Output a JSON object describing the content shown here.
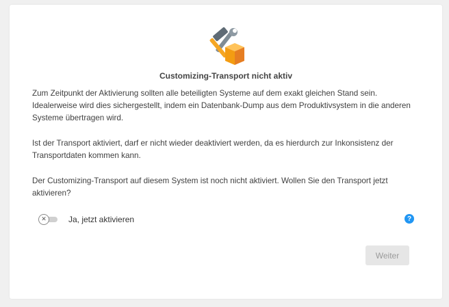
{
  "dialog": {
    "icon": "hammer-wrench-box-icon",
    "title": "Customizing-Transport nicht aktiv",
    "paragraph1": "Zum Zeitpunkt der Aktivierung sollten alle beteiligten Systeme auf dem exakt gleichen Stand sein. Idealerweise wird dies sichergestellt, indem ein Datenbank-Dump aus dem Produktivsystem in die anderen Systeme übertragen wird.",
    "paragraph2": "Ist der Transport aktiviert, darf er nicht wieder deaktiviert werden, da es hierdurch zur Inkonsistenz der Transportdaten kommen kann.",
    "paragraph3": "Der Customizing-Transport auf diesem System ist noch nicht aktiviert. Wollen Sie den Transport jetzt aktivieren?"
  },
  "toggle": {
    "label": "Ja, jetzt aktivieren",
    "checked": false,
    "knob_glyph": "✕"
  },
  "help": {
    "glyph": "?",
    "color": "#2196f3"
  },
  "next_button": {
    "label": "Weiter",
    "disabled": true
  }
}
